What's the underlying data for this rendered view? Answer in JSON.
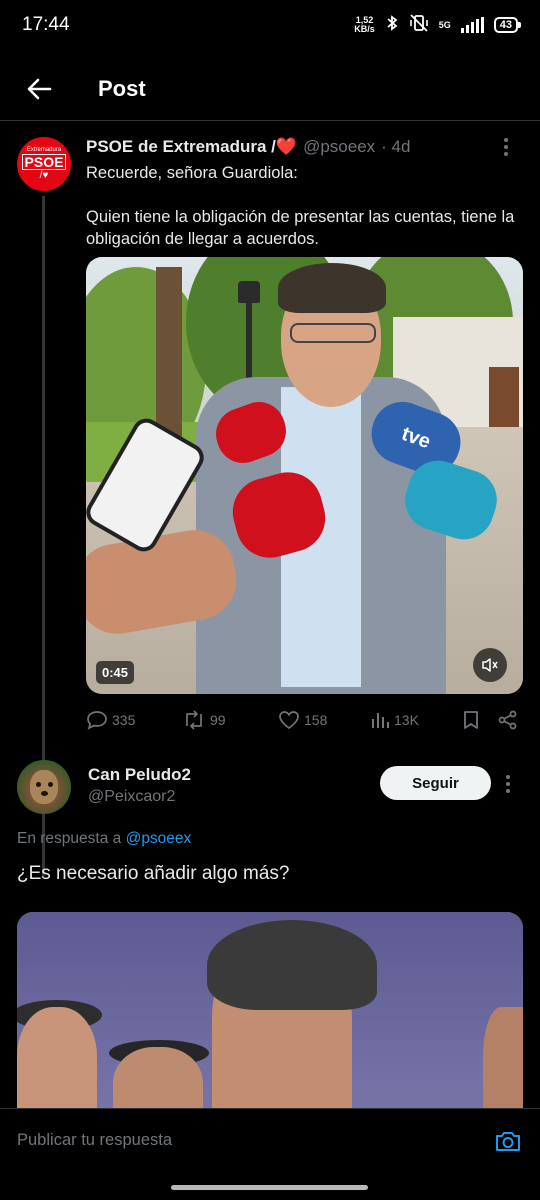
{
  "status_bar": {
    "time": "17:44",
    "net_speed": "1,52",
    "net_unit": "KB/s",
    "network_type": "5G",
    "battery": "43"
  },
  "header": {
    "title": "Post"
  },
  "tweet": {
    "author_name": "PSOE de Extremadura /❤️",
    "author_handle": "@psoeex",
    "time_ago": "· 4d",
    "avatar_text_top": "Extremadura",
    "avatar_text_main": "PSOE",
    "avatar_text_bottom": "/♥",
    "text_line1": "Recuerde, señora Guardiola:",
    "text_line2": "Quien tiene la obligación de presentar las cuentas, tiene la obligación de llegar a acuerdos.",
    "video_duration": "0:45",
    "mic_label": "tve",
    "replies": "335",
    "reposts": "99",
    "likes": "158",
    "views": "13K"
  },
  "reply": {
    "author_name": "Can Peludo2",
    "author_handle": "@Peixcaor2",
    "follow_label": "Seguir",
    "reply_to_prefix": "En respuesta a",
    "reply_to_mention": "@psoeex",
    "text": "¿Es necesario añadir algo más?"
  },
  "composer": {
    "placeholder": "Publicar tu respuesta"
  },
  "colors": {
    "background": "#000000",
    "text_primary": "#e7e9ea",
    "text_secondary": "#71767b",
    "accent": "#1d9bf0",
    "psoe_red": "#e30613"
  },
  "icons": [
    "back-arrow-icon",
    "more-icon",
    "reply-icon",
    "repost-icon",
    "like-icon",
    "views-icon",
    "bookmark-icon",
    "share-icon",
    "mute-icon",
    "camera-icon",
    "bluetooth-icon",
    "vibrate-off-icon",
    "signal-icon",
    "battery-icon"
  ]
}
